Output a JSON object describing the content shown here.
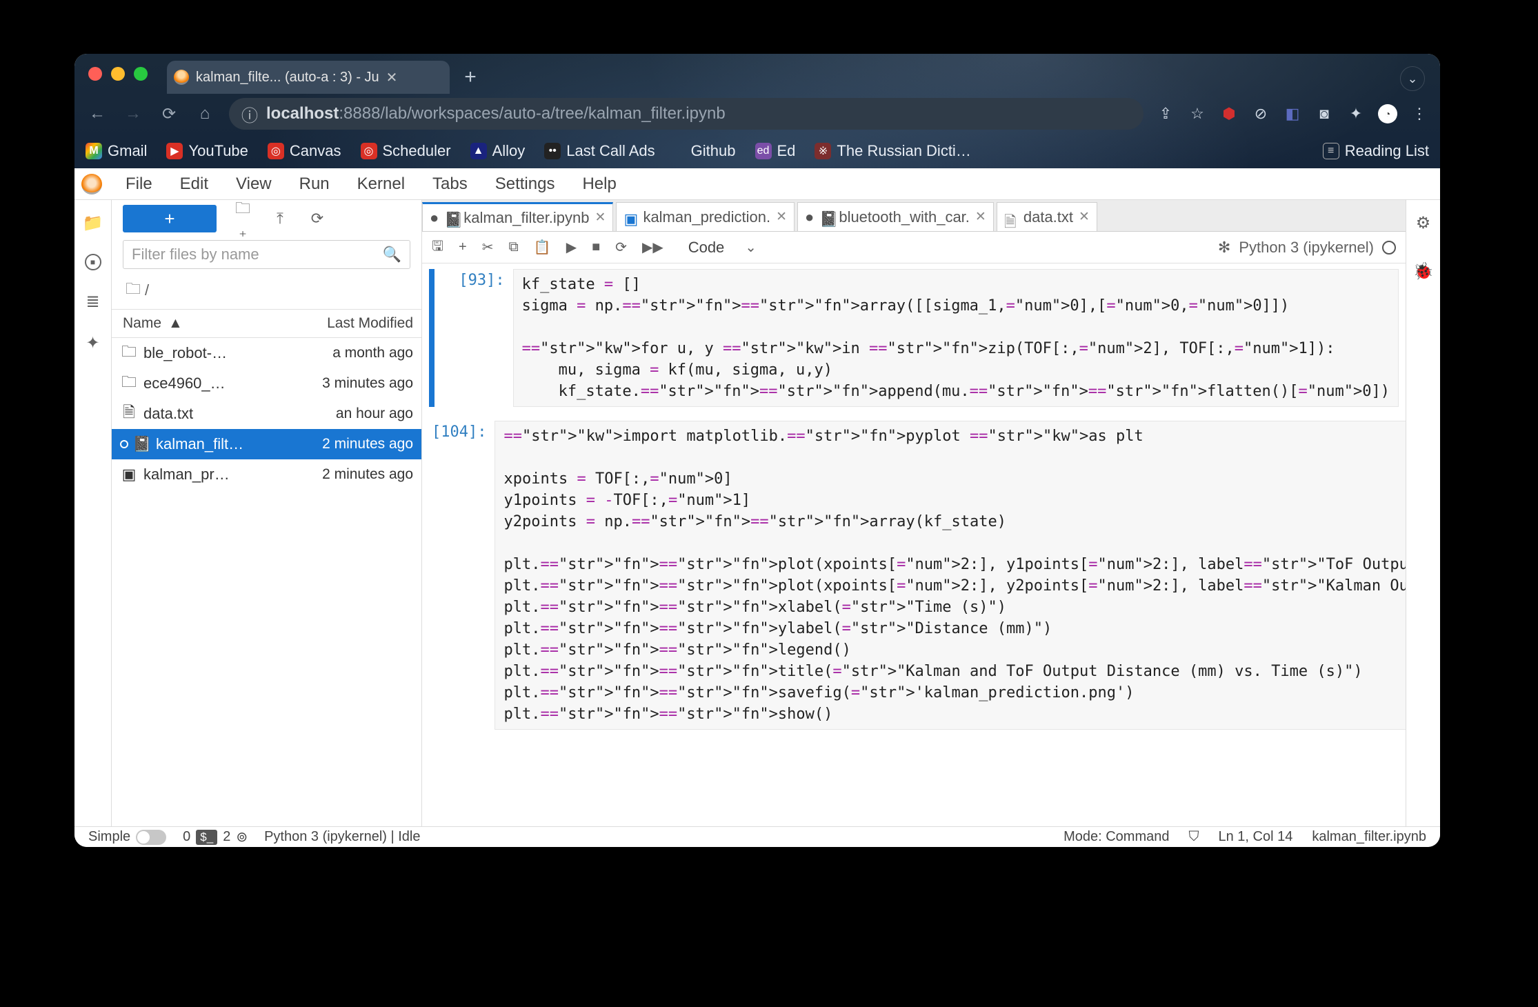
{
  "browser": {
    "tab_title": "kalman_filte... (auto-a : 3) - Ju",
    "url_host": "localhost",
    "url_port_path": ":8888/lab/workspaces/auto-a/tree/kalman_filter.ipynb",
    "bookmarks": [
      "Gmail",
      "YouTube",
      "Canvas",
      "Scheduler",
      "Alloy",
      "Last Call Ads",
      "Github",
      "Ed",
      "The Russian Dicti…"
    ],
    "reading_list": "Reading List"
  },
  "menu": [
    "File",
    "Edit",
    "View",
    "Run",
    "Kernel",
    "Tabs",
    "Settings",
    "Help"
  ],
  "sidebar": {
    "filter_placeholder": "Filter files by name",
    "breadcrumb": "/",
    "cols": {
      "name": "Name",
      "mod": "Last Modified"
    },
    "rows": [
      {
        "icon": "folder",
        "name": "ble_robot-…",
        "mod": "a month ago",
        "sel": false
      },
      {
        "icon": "folder",
        "name": "ece4960_…",
        "mod": "3 minutes ago",
        "sel": false
      },
      {
        "icon": "file",
        "name": "data.txt",
        "mod": "an hour ago",
        "sel": false
      },
      {
        "icon": "nb",
        "name": "kalman_filt…",
        "mod": "2 minutes ago",
        "sel": true
      },
      {
        "icon": "img",
        "name": "kalman_pr…",
        "mod": "2 minutes ago",
        "sel": false
      }
    ]
  },
  "tabs": [
    {
      "icon": "nb",
      "label": "kalman_filter.ipynb",
      "dirty": true,
      "active": true
    },
    {
      "icon": "img",
      "label": "kalman_prediction.",
      "active": false
    },
    {
      "icon": "nb",
      "label": "bluetooth_with_car.",
      "dirty": true,
      "active": false
    },
    {
      "icon": "file",
      "label": "data.txt",
      "active": false
    }
  ],
  "toolbar": {
    "celltype": "Code",
    "kernel": "Python 3 (ipykernel)"
  },
  "cells": [
    {
      "prompt": "[93]:",
      "active": true,
      "code": "kf_state = []\nsigma = np.array([[sigma_1,0],[0,0]])\n\nfor u, y in zip(TOF[:,2], TOF[:,1]):\n    mu, sigma = kf(mu, sigma, u,y)\n    kf_state.append(mu.flatten()[0])"
    },
    {
      "prompt": "[104]:",
      "active": false,
      "code": "import matplotlib.pyplot as plt\n\nxpoints = TOF[:,0]\ny1points = -TOF[:,1]\ny2points = np.array(kf_state)\n\nplt.plot(xpoints[2:], y1points[2:], label=\"ToF Output\")\nplt.plot(xpoints[2:], y2points[2:], label=\"Kalman Output\")\nplt.xlabel(\"Time (s)\")\nplt.ylabel(\"Distance (mm)\")\nplt.legend()\nplt.title(\"Kalman and ToF Output Distance (mm) vs. Time (s)\")\nplt.savefig('kalman_prediction.png')\nplt.show()"
    }
  ],
  "status": {
    "simple": "Simple",
    "n0": "0",
    "n1": "2",
    "kernel": "Python 3 (ipykernel) | Idle",
    "mode": "Mode: Command",
    "pos": "Ln 1, Col 14",
    "file": "kalman_filter.ipynb"
  }
}
